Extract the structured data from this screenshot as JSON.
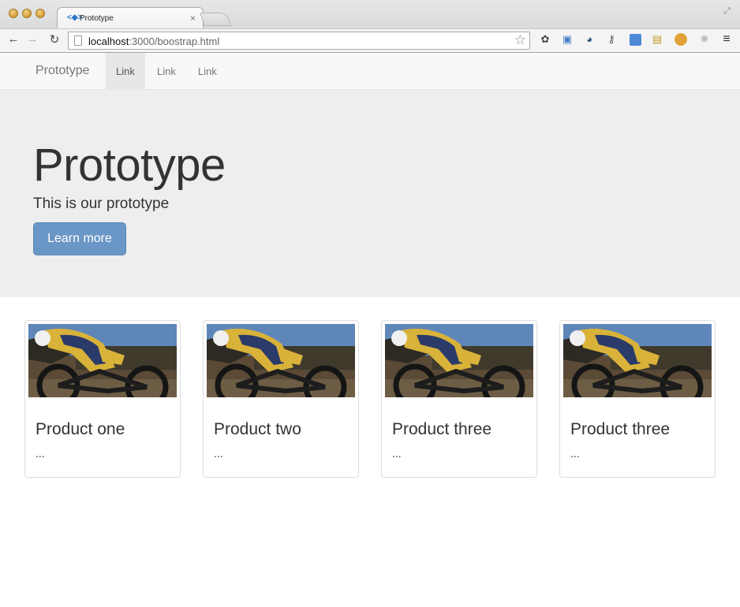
{
  "browser": {
    "tab_title": "Prototype",
    "tab_close": "×",
    "url_host": "localhost",
    "url_path": ":3000/boostrap.html"
  },
  "navbar": {
    "brand": "Prototype",
    "links": [
      "Link",
      "Link",
      "Link"
    ]
  },
  "jumbotron": {
    "heading": "Prototype",
    "lead": "This is our prototype",
    "button": "Learn more"
  },
  "products": [
    {
      "title": "Product one",
      "desc": "..."
    },
    {
      "title": "Product two",
      "desc": "..."
    },
    {
      "title": "Product three",
      "desc": "..."
    },
    {
      "title": "Product three",
      "desc": "..."
    }
  ],
  "colors": {
    "primary_button": "#6b97c7",
    "jumbotron_bg": "#eeeeee",
    "navbar_bg": "#f8f8f8"
  }
}
